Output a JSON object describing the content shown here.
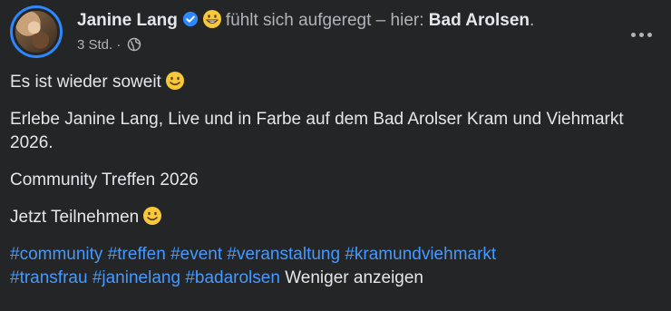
{
  "post": {
    "author": "Janine Lang",
    "feeling": "fühlt sich aufgeregt – hier:",
    "location": "Bad Arolsen",
    "location_suffix": ".",
    "time": "3 Std.",
    "separator": "·",
    "privacy_icon": "globe-icon",
    "verified_icon": "verified-badge-icon",
    "feeling_icon": "grinning-face-icon",
    "more_icon": "more-options-icon",
    "paragraphs": {
      "p1": "Es ist wieder soweit",
      "p2": "Erlebe Janine Lang, Live und in Farbe auf dem Bad Arolser Kram und Viehmarkt 2026.",
      "p3": "Community Treffen 2026",
      "p4": "Jetzt Teilnehmen"
    },
    "hashtags": [
      "#community",
      "#treffen",
      "#event",
      "#veranstaltung",
      "#kramundviehmarkt",
      "#transfrau",
      "#janinelang",
      "#badarolsen"
    ],
    "show_less": "Weniger anzeigen"
  },
  "colors": {
    "background": "#242526",
    "text": "#e4e6eb",
    "secondary": "#b0b3b8",
    "link": "#4599ff",
    "verified": "#2d88ff",
    "emoji": "#f7c83a"
  }
}
